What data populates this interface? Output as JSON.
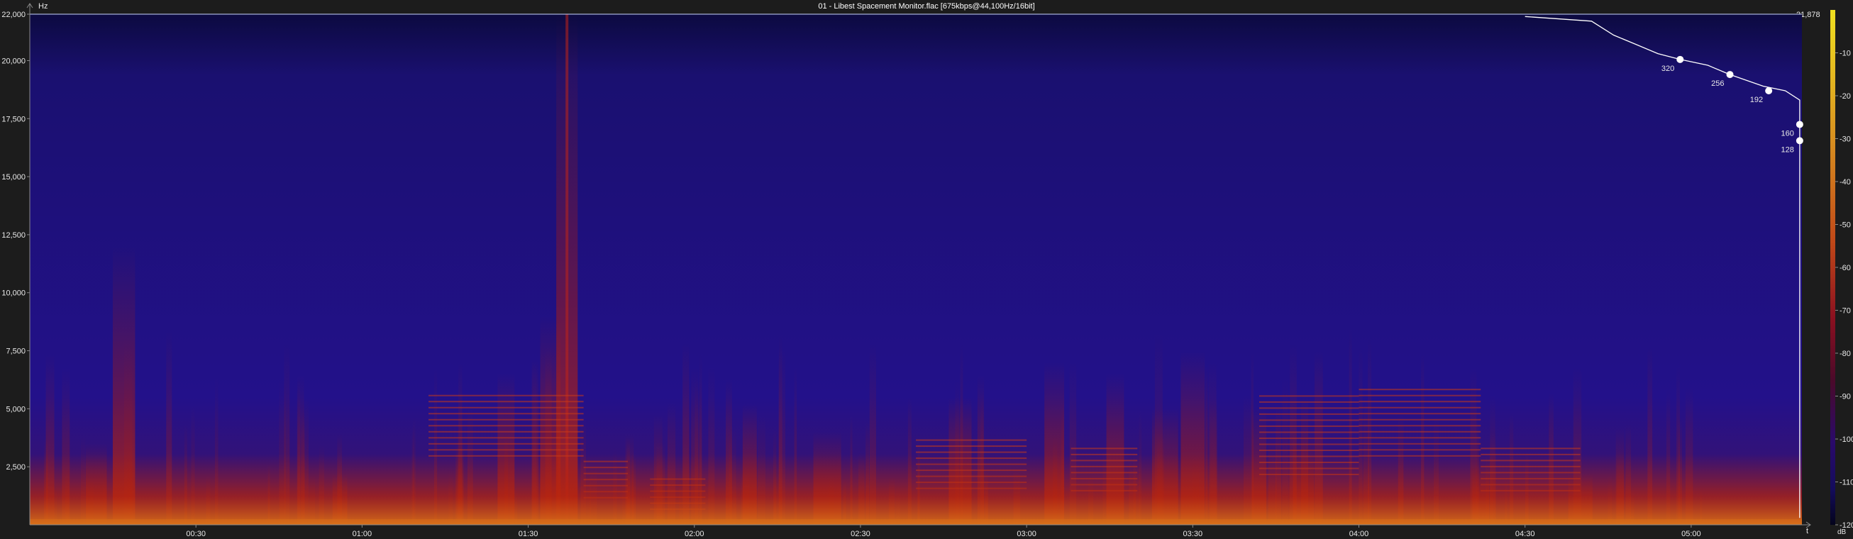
{
  "title": "01 - Libest Spacement Monitor.flac [675kbps@44,100Hz/16bit]",
  "y_unit": "Hz",
  "x_unit": "t",
  "colorbar_unit": "dB",
  "top_frequency_label": "21,878",
  "colors": {
    "background": "#1c1c1c",
    "spectrogram_base": "#18107a",
    "spectrogram_low": "#0a0a3c",
    "spectrogram_energy": "#b0200c",
    "spectrogram_hot": "#e8b020",
    "axis": "#8a8a8a",
    "text": "#e8e8e8",
    "top_line": "#ffffff"
  },
  "chart_data": {
    "type": "heatmap",
    "title": "01 - Libest Spacement Monitor.flac [675kbps@44,100Hz/16bit]",
    "ylim": [
      0,
      22000
    ],
    "xlim_seconds": [
      0,
      320
    ],
    "y_ticks": [
      {
        "value": 22000,
        "label": "22,000"
      },
      {
        "value": 20000,
        "label": "20,000"
      },
      {
        "value": 17500,
        "label": "17,500"
      },
      {
        "value": 15000,
        "label": "15,000"
      },
      {
        "value": 12500,
        "label": "12,500"
      },
      {
        "value": 10000,
        "label": "10,000"
      },
      {
        "value": 7500,
        "label": "7,500"
      },
      {
        "value": 5000,
        "label": "5,000"
      },
      {
        "value": 2500,
        "label": "2,500"
      }
    ],
    "x_ticks": [
      {
        "value": 30,
        "label": "00:30"
      },
      {
        "value": 60,
        "label": "01:00"
      },
      {
        "value": 90,
        "label": "01:30"
      },
      {
        "value": 120,
        "label": "02:00"
      },
      {
        "value": 150,
        "label": "02:30"
      },
      {
        "value": 180,
        "label": "03:00"
      },
      {
        "value": 210,
        "label": "03:30"
      },
      {
        "value": 240,
        "label": "04:00"
      },
      {
        "value": 270,
        "label": "04:30"
      },
      {
        "value": 300,
        "label": "05:00"
      }
    ],
    "colorbar": {
      "range": [
        -120,
        0
      ],
      "ticks": [
        {
          "value": -10,
          "label": "-10"
        },
        {
          "value": -20,
          "label": "-20"
        },
        {
          "value": -30,
          "label": "-30"
        },
        {
          "value": -40,
          "label": "-40"
        },
        {
          "value": -50,
          "label": "-50"
        },
        {
          "value": -60,
          "label": "-60"
        },
        {
          "value": -70,
          "label": "-70"
        },
        {
          "value": -80,
          "label": "-80"
        },
        {
          "value": -90,
          "label": "-90"
        },
        {
          "value": -100,
          "label": "-100"
        },
        {
          "value": -110,
          "label": "-110"
        },
        {
          "value": -120,
          "label": "-120"
        }
      ],
      "stops": [
        "#f0e020",
        "#d89020",
        "#c04818",
        "#8a1020",
        "#4a0a2a",
        "#2a0a6a",
        "#140c5c",
        "#04041c"
      ]
    },
    "bitrate_markers": [
      {
        "label": "320",
        "freq": 20050
      },
      {
        "label": "256",
        "freq": 19400
      },
      {
        "label": "192",
        "freq": 18700
      },
      {
        "label": "160",
        "freq": 17250
      },
      {
        "label": "128",
        "freq": 16550
      }
    ]
  }
}
